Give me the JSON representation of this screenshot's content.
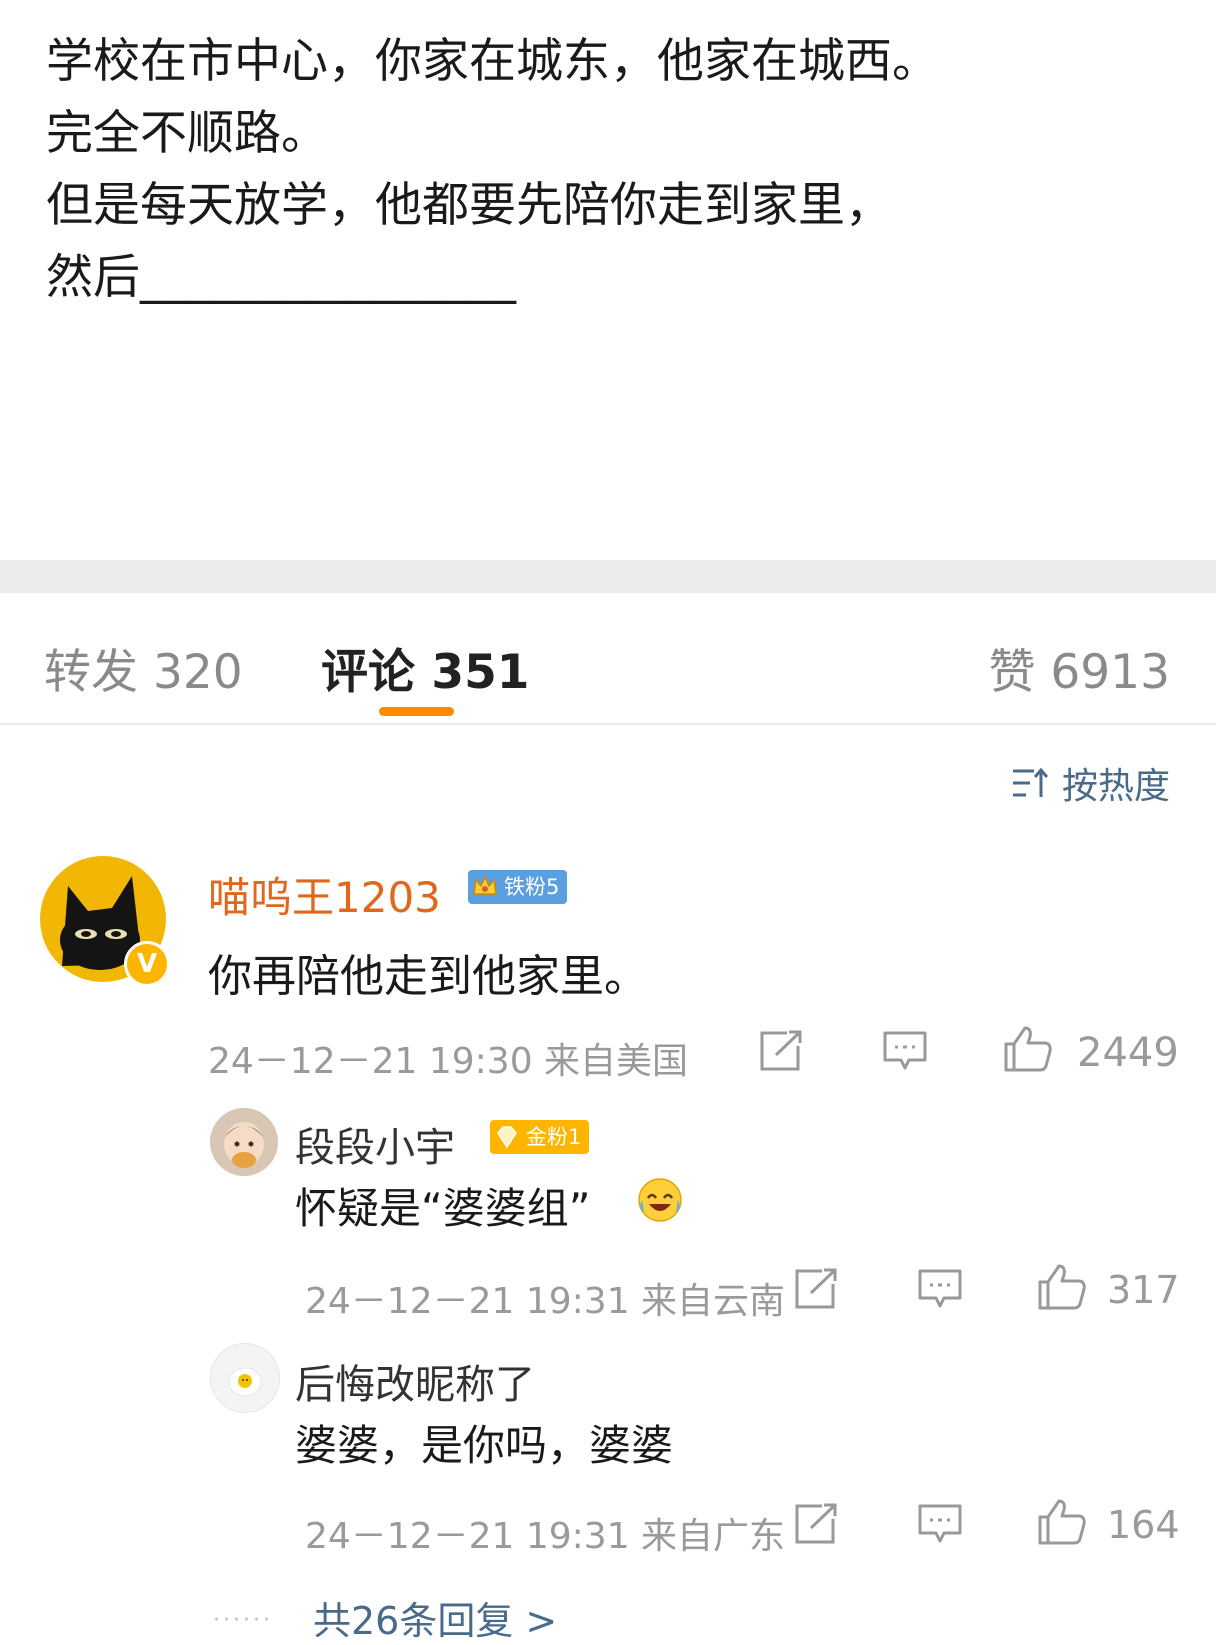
{
  "post": {
    "lines": [
      "学校在市中心，你家在城东，他家在城西。",
      "完全不顺路。",
      "但是每天放学，他都要先陪你走到家里，",
      "然后________________"
    ]
  },
  "tabs": {
    "repost": "转发 320",
    "comment": "评论 351",
    "like": "赞 6913"
  },
  "sort": {
    "label": "按热度",
    "icon": "sort-hot-icon"
  },
  "colors": {
    "accent": "#ff8a00",
    "username": "#e0681c",
    "link": "#4a6a8a",
    "meta": "#9a9a9a"
  },
  "comments": [
    {
      "user": "喵呜王1203",
      "badge": "铁粉5",
      "verified": "V",
      "text": "你再陪他走到他家里。",
      "meta": "24－12－21 19:30 来自美国",
      "likes": "2449"
    }
  ],
  "replies": [
    {
      "user": "段段小宇",
      "badge": "金粉1",
      "text": "怀疑是“婆婆组”",
      "meta": "24－12－21 19:31 来自云南",
      "likes": "317"
    },
    {
      "user": "后悔改昵称了",
      "text": "婆婆，是你吗，婆婆",
      "meta": "24－12－21 19:31 来自广东",
      "likes": "164"
    }
  ],
  "more_replies": "共26条回复 >",
  "more_dots": "······"
}
